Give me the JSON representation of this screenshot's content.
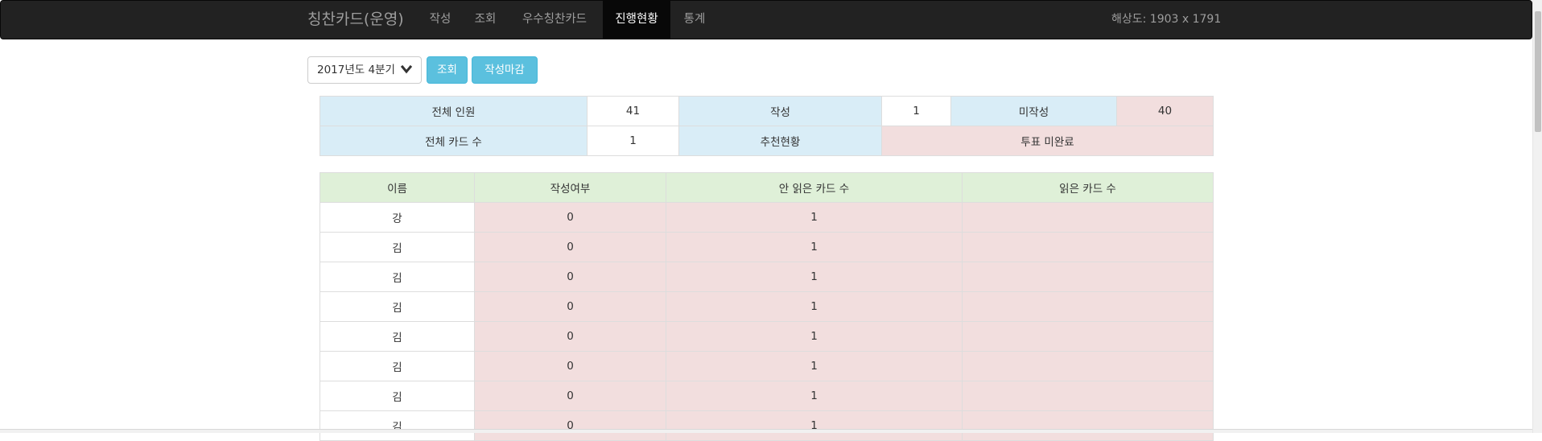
{
  "navbar": {
    "brand": "칭찬카드(운영)",
    "items": [
      {
        "label": "작성"
      },
      {
        "label": "조회"
      },
      {
        "label": "우수칭찬카드"
      },
      {
        "label": "진행현황"
      },
      {
        "label": "통계"
      }
    ],
    "active_index": 3,
    "resolution_text": "해상도: 1903 x 1791"
  },
  "controls": {
    "period_select_value": "2017년도 4분기",
    "search_button": "조회",
    "close_writing_button": "작성마감"
  },
  "summary": {
    "total_members_label": "전체 인원",
    "total_members_value": "41",
    "written_label": "작성",
    "written_value": "1",
    "not_written_label": "미작성",
    "not_written_value": "40",
    "total_cards_label": "전체 카드 수",
    "total_cards_value": "1",
    "recommend_label": "추천현황",
    "vote_status": "투표 미완료"
  },
  "status_table": {
    "headers": [
      "이름",
      "작성여부",
      "안 읽은 카드 수",
      "읽은 카드 수"
    ],
    "rows": [
      {
        "name": "강",
        "written": "0",
        "unread": "1",
        "read": ""
      },
      {
        "name": "김",
        "written": "0",
        "unread": "1",
        "read": ""
      },
      {
        "name": "김",
        "written": "0",
        "unread": "1",
        "read": ""
      },
      {
        "name": "김",
        "written": "0",
        "unread": "1",
        "read": ""
      },
      {
        "name": "김",
        "written": "0",
        "unread": "1",
        "read": ""
      },
      {
        "name": "김",
        "written": "0",
        "unread": "1",
        "read": ""
      },
      {
        "name": "김",
        "written": "0",
        "unread": "1",
        "read": ""
      },
      {
        "name": "김",
        "written": "0",
        "unread": "1",
        "read": ""
      }
    ]
  },
  "colors": {
    "navbar_bg": "#222222",
    "nav_active_bg": "#080808",
    "info_button": "#5bc0de",
    "info_cell": "#d9edf7",
    "danger_cell": "#f2dede",
    "success_header": "#dff0d8"
  },
  "icons": {
    "period_dropdown": "chevron-down-icon"
  }
}
